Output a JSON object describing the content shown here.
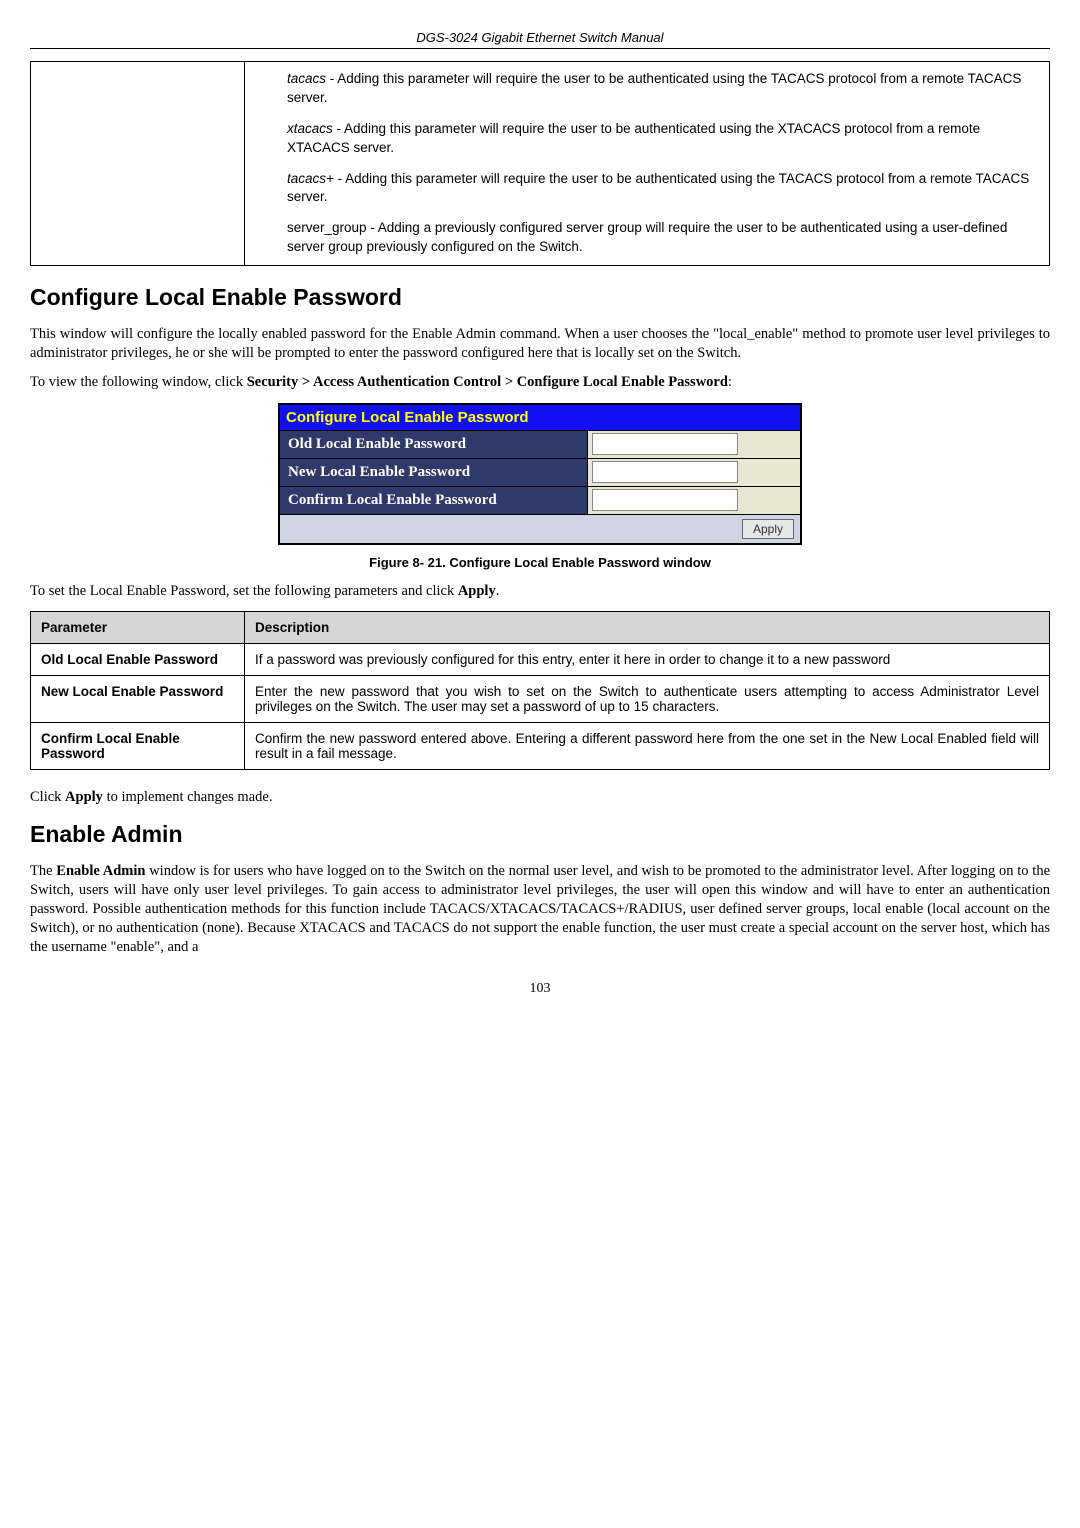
{
  "header": {
    "manual_title": "DGS-3024 Gigabit Ethernet Switch Manual"
  },
  "protocol_table": {
    "items": [
      {
        "name": "tacacs",
        "desc": " - Adding this parameter will require the user to be authenticated using the TACACS protocol from a remote TACACS server."
      },
      {
        "name": "xtacacs",
        "desc": " - Adding this parameter will require the user to be authenticated using the XTACACS protocol from a remote XTACACS server."
      },
      {
        "name": "tacacs+",
        "desc": " - Adding this parameter will require the user to be authenticated using the TACACS protocol from a remote TACACS server."
      },
      {
        "name": "server_group",
        "desc": " - Adding a previously configured server group will require the user to be authenticated using a user-defined server group previously configured on the Switch.",
        "noitalic": true
      }
    ]
  },
  "section1": {
    "title": "Configure Local Enable Password",
    "para1": "This window will configure the locally enabled password for the Enable Admin command. When a user chooses the \"local_enable\" method to promote user level privileges to administrator privileges, he or she will be prompted to enter the password configured here that is locally set on the Switch.",
    "para2_prefix": "To view the following window, click ",
    "para2_bold": "Security  > Access Authentication Control > Configure Local Enable Password",
    "para2_suffix": ":"
  },
  "config_window": {
    "title": "Configure Local Enable Password",
    "rows": [
      "Old Local Enable Password",
      "New Local Enable Password",
      "Confirm Local Enable Password"
    ],
    "apply": "Apply"
  },
  "figure_caption": "Figure 8- 21. Configure Local Enable Password window",
  "set_params": {
    "prefix": "To set the Local Enable Password, set the following parameters and click ",
    "bold": "Apply",
    "suffix": "."
  },
  "param_table": {
    "header_param": "Parameter",
    "header_desc": "Description",
    "rows": [
      {
        "param": "Old Local Enable Password",
        "desc": "If a password was previously configured for this entry, enter it here in order to change it to a new password"
      },
      {
        "param": "New Local Enable Password",
        "desc": "Enter the new password that you wish to set on the Switch to authenticate users attempting to access Administrator Level privileges on the Switch. The user may set a password of up to 15 characters."
      },
      {
        "param": "Confirm Local Enable Password",
        "desc": "Confirm the new password entered above. Entering a different password here from the one set in the New Local Enabled field will result in a fail message."
      }
    ]
  },
  "apply_note": {
    "prefix": "Click ",
    "bold": "Apply",
    "suffix": " to implement changes made."
  },
  "section2": {
    "title": "Enable Admin",
    "para_parts": {
      "p1": "The ",
      "b1": "Enable Admin",
      "p2": " window is for users who have logged on to the Switch on the normal user level, and wish to be promoted to the administrator level. After logging on to the Switch, users will have only user level privileges. To gain access to administrator level privileges, the user will open this window and will have to enter an authentication password. Possible authentication methods for this function include TACACS/XTACACS/TACACS+/RADIUS, user defined server groups, local enable (local account on the Switch), or no authentication (none). Because XTACACS and TACACS do not support the enable function, the user must create a special account on the server host, which has the username \"enable\", and a"
    }
  },
  "page_number": "103"
}
